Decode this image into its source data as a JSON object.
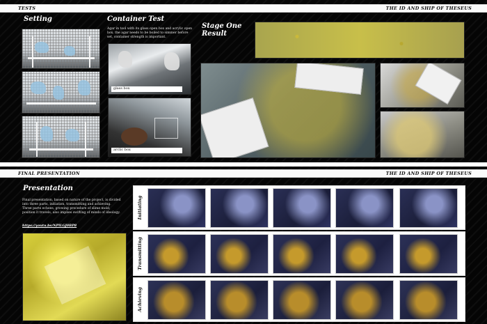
{
  "top": {
    "strip_left": "TESTS",
    "strip_right": "THE ID AND SHIP OF THESEUS",
    "setting": {
      "title": "Setting"
    },
    "container_test": {
      "title": "Container Test",
      "description": "Agar in tool with its glass open box and acrylic open box. the agar needs to be boiled to simmer before set, container strength is important.",
      "glass_caption": "glass box",
      "acrylic_caption": "arclic box"
    },
    "stage_one": {
      "title_line1": "Stage One",
      "title_line2": "Result"
    }
  },
  "bottom": {
    "strip_left": "FINAL PRESENTATION",
    "strip_right": "THE ID AND SHIP OF THESEUS",
    "presentation": {
      "title": "Presentation",
      "description": "Final presentation, based on nature of the project, is divided into three parts, initiation, transmitting and achieving. Three parts echoes, growing procedure of slime mold, position it travels, also implies swifting of minds of ideology.",
      "link": "https://youtu.be/NPlLGJ0BP8"
    },
    "stages": [
      {
        "label": "Initiating"
      },
      {
        "label": "Transmitting"
      },
      {
        "label": "Achieving"
      }
    ]
  }
}
